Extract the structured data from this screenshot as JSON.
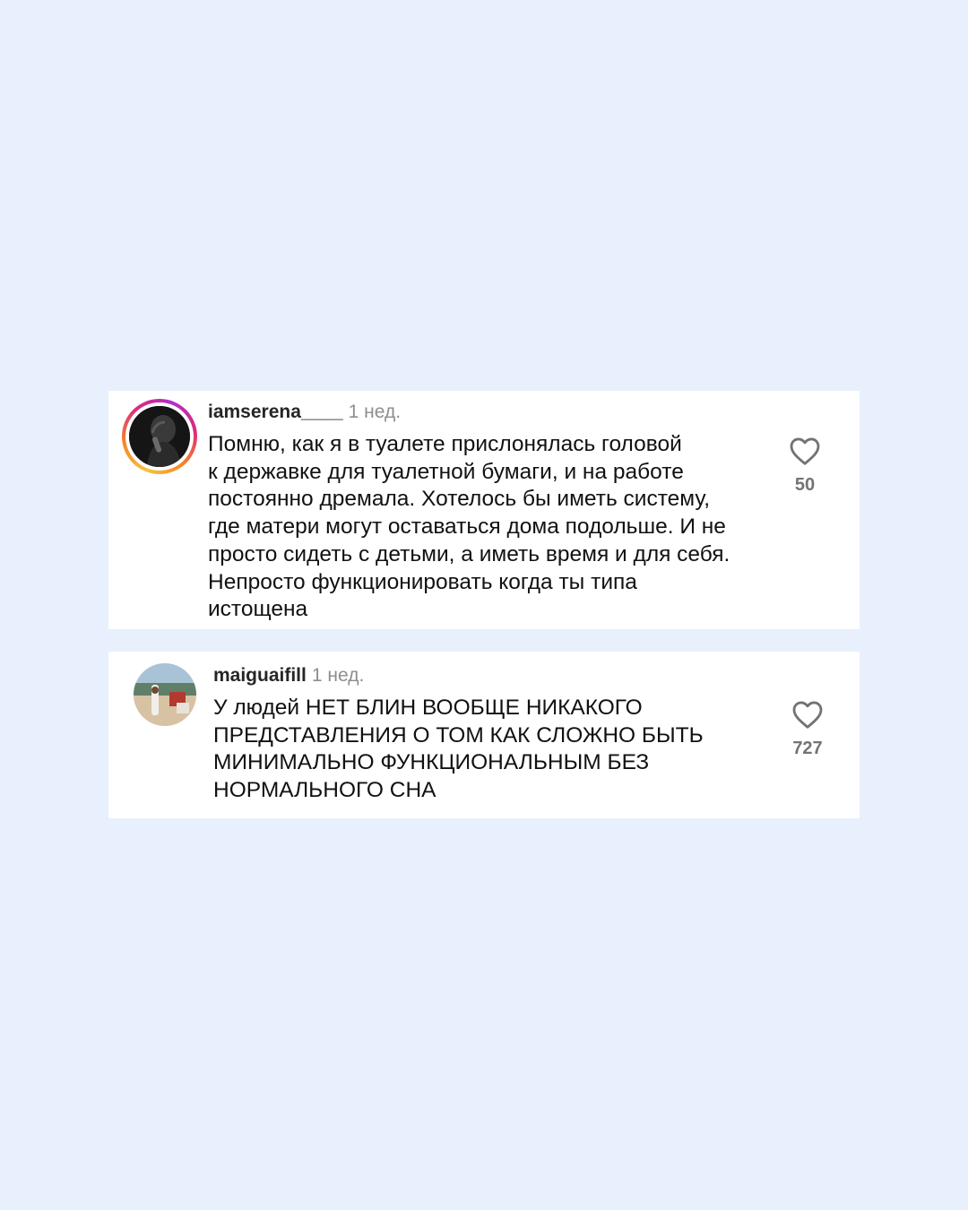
{
  "comments": [
    {
      "username": "iamserena____",
      "time": "1 нед.",
      "lines": [
        "Помню, как я в туалете прислонялась головой",
        "к державке для туалетной бумаги, и на работе",
        "постоянно дремала. Хотелось бы иметь систему,",
        "где матери могут оставаться дома подольше. И не",
        "просто сидеть с детьми, а иметь время и для себя.",
        "Непросто функционировать когда ты типа",
        "истощена"
      ],
      "likes": "50",
      "avatar_story_ring": true
    },
    {
      "username": "maiguaifill",
      "time": "1 нед.",
      "lines": [
        "У людей НЕТ БЛИН ВООБЩЕ НИКАКОГО",
        "ПРЕДСТАВЛЕНИЯ О ТОМ КАК СЛОЖНО БЫТЬ",
        "МИНИМАЛЬНО ФУНКЦИОНАЛЬНЫМ БЕЗ",
        "НОРМАЛЬНОГО СНА"
      ],
      "likes": "727",
      "avatar_story_ring": false
    }
  ],
  "icons": {
    "like": "heart-outline-icon"
  },
  "colors": {
    "background": "#e8f0fd",
    "card": "#ffffff",
    "text": "#111111",
    "muted": "#8e8e8e"
  }
}
